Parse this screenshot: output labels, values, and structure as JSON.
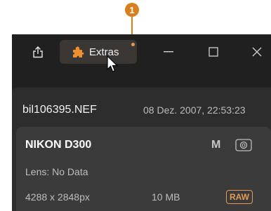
{
  "callout": {
    "number": "1"
  },
  "titlebar": {
    "share_icon": "share-icon",
    "extras_label": "Extras",
    "extras_icon": "puzzle-icon",
    "minimize_icon": "minimize-icon",
    "maximize_icon": "maximize-icon",
    "close_icon": "close-icon"
  },
  "file": {
    "name": "bil106395.NEF",
    "datetime": "08 Dez. 2007, 22:53:23"
  },
  "camera": {
    "model": "NIKON D300",
    "mode": "M",
    "lens": "Lens: No Data",
    "resolution": "4288 x 2848px",
    "size": "10 MB",
    "format": "RAW"
  },
  "colors": {
    "accent": "#d97e1f",
    "raw_badge": "#e59a55",
    "window_bg": "#202020",
    "panel_bg": "#2d2d2d",
    "card_bg": "#3b3b3b"
  }
}
